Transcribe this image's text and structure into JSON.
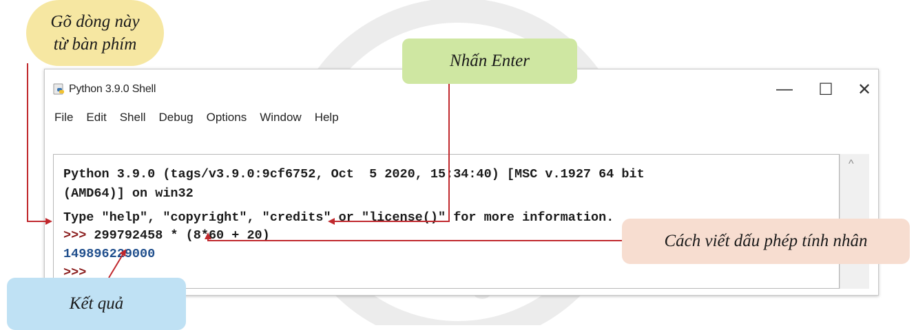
{
  "window": {
    "title": "Python 3.9.0 Shell",
    "minimize_glyph": "—",
    "maximize_glyph": "☐",
    "close_glyph": "✕"
  },
  "menu": [
    "File",
    "Edit",
    "Shell",
    "Debug",
    "Options",
    "Window",
    "Help"
  ],
  "shell": {
    "line1": "Python 3.9.0 (tags/v3.9.0:9cf6752, Oct  5 2020, 15:34:40) [MSC v.1927 64 bit",
    "line2": "(AMD64)] on win32",
    "line3": "Type \"help\", \"copyright\", \"credits\" or \"license()\" for more information.",
    "prompt": ">>>",
    "command": " 299792458 * (8*60 + 20)",
    "result": "149896229000",
    "prompt2": ">>>"
  },
  "callouts": {
    "type_line_1": "Gõ dòng này",
    "type_line_2": "từ bàn phím",
    "press_enter": "Nhấn Enter",
    "multiply_sign": "Cách viết dấu phép tính nhân",
    "result": "Kết quả"
  },
  "colors": {
    "prompt": "#8a1c1c",
    "output": "#1f4e8c",
    "arrow": "#c0282d",
    "callout_yellow": "#f6e7a2",
    "callout_green": "#cfe7a2",
    "callout_blue": "#bfe1f4",
    "callout_pink": "#f7ddd0"
  },
  "icons": {
    "app": "python-icon",
    "scroll": "scroll-up-icon"
  }
}
